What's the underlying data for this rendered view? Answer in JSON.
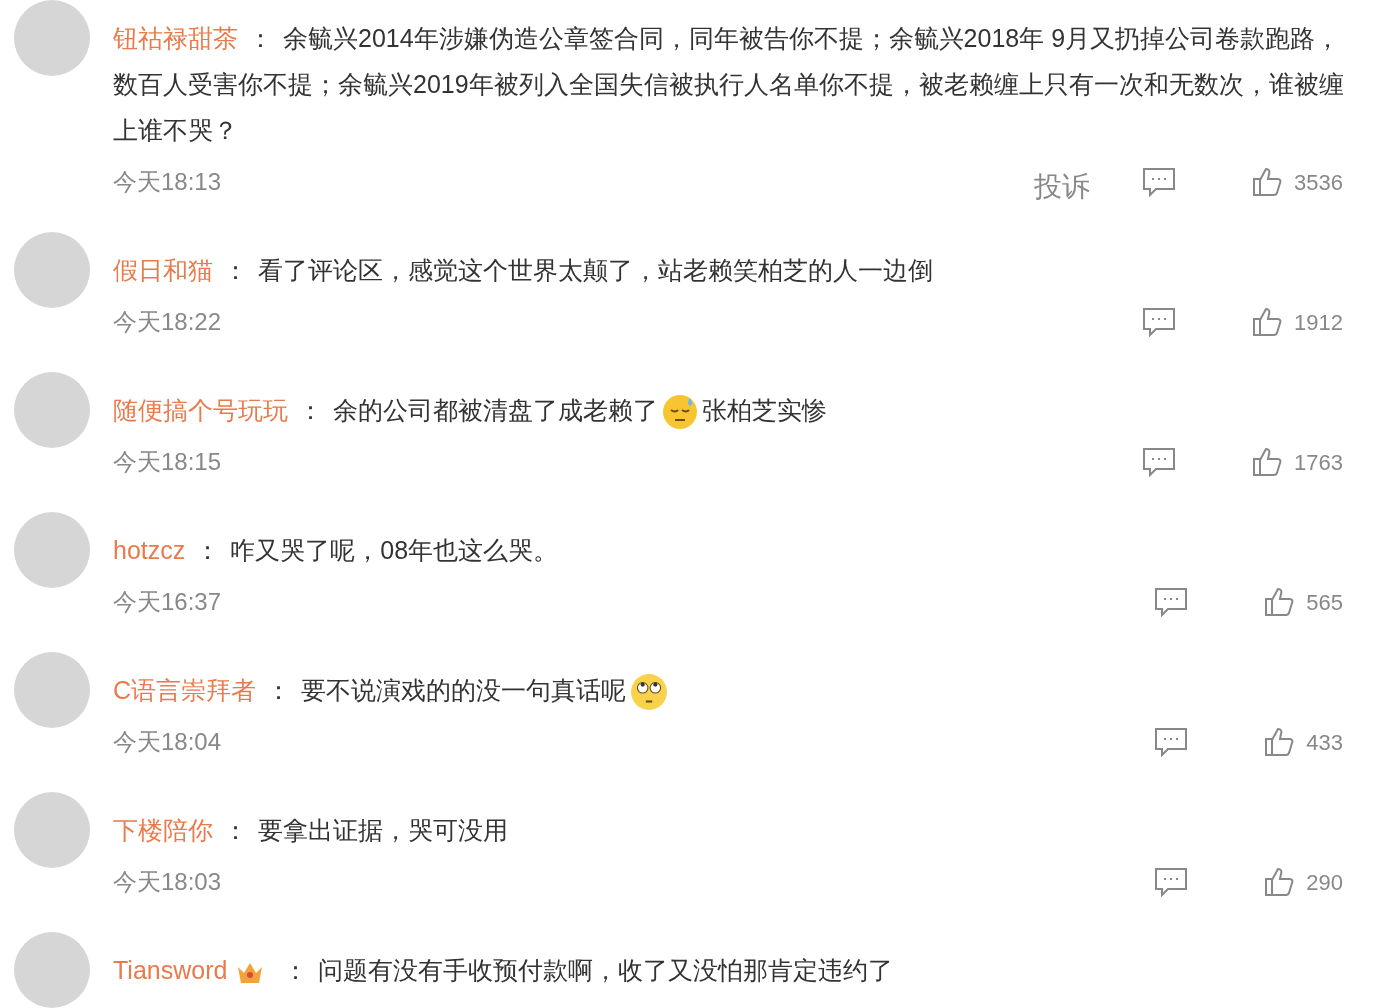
{
  "comments": [
    {
      "name": "钮祜禄甜茶",
      "badge": false,
      "separator": "：",
      "segments": [
        {
          "kind": "text",
          "text": "余毓兴2014年涉嫌伪造公章签合同，同年被告你不提；余毓兴2018年 9月又扔掉公司卷款跑路，数百人受害你不提；余毓兴2019年被列入全国失信被执行人名单你不提，被老赖缠上只有一次和无数次，谁被缠上谁不哭？"
        }
      ],
      "time": "今天18:13",
      "report": "投诉",
      "likes": "3536"
    },
    {
      "name": "假日和猫",
      "badge": false,
      "separator": "：",
      "segments": [
        {
          "kind": "text",
          "text": "看了评论区，感觉这个世界太颠了，站老赖笑柏芝的人一边倒"
        }
      ],
      "time": "今天18:22",
      "likes": "1912"
    },
    {
      "name": "随便搞个号玩玩",
      "badge": false,
      "separator": "：",
      "segments": [
        {
          "kind": "text",
          "text": "余的公司都被清盘了成老赖了"
        },
        {
          "kind": "sweat"
        },
        {
          "kind": "text",
          "text": "张柏芝实惨"
        }
      ],
      "time": "今天18:15",
      "likes": "1763"
    },
    {
      "name": "hotzcz",
      "badge": false,
      "separator": "：",
      "segments": [
        {
          "kind": "text",
          "text": "咋又哭了呢，08年也这么哭。"
        }
      ],
      "time": "今天16:37",
      "likes": "565"
    },
    {
      "name": "C语言崇拜者",
      "badge": false,
      "separator": "：",
      "segments": [
        {
          "kind": "text",
          "text": "要不说演戏的的没一句真话呢"
        },
        {
          "kind": "eyeroll"
        }
      ],
      "time": "今天18:04",
      "likes": "433"
    },
    {
      "name": "下楼陪你",
      "badge": false,
      "separator": "：",
      "segments": [
        {
          "kind": "text",
          "text": "要拿出证据，哭可没用"
        }
      ],
      "time": "今天18:03",
      "likes": "290"
    },
    {
      "name": "Tiansword",
      "badge": true,
      "separator": "：",
      "segments": [
        {
          "kind": "text",
          "text": "问题有没有手收预付款啊，收了又没怕那肯定违约了"
        }
      ]
    }
  ]
}
